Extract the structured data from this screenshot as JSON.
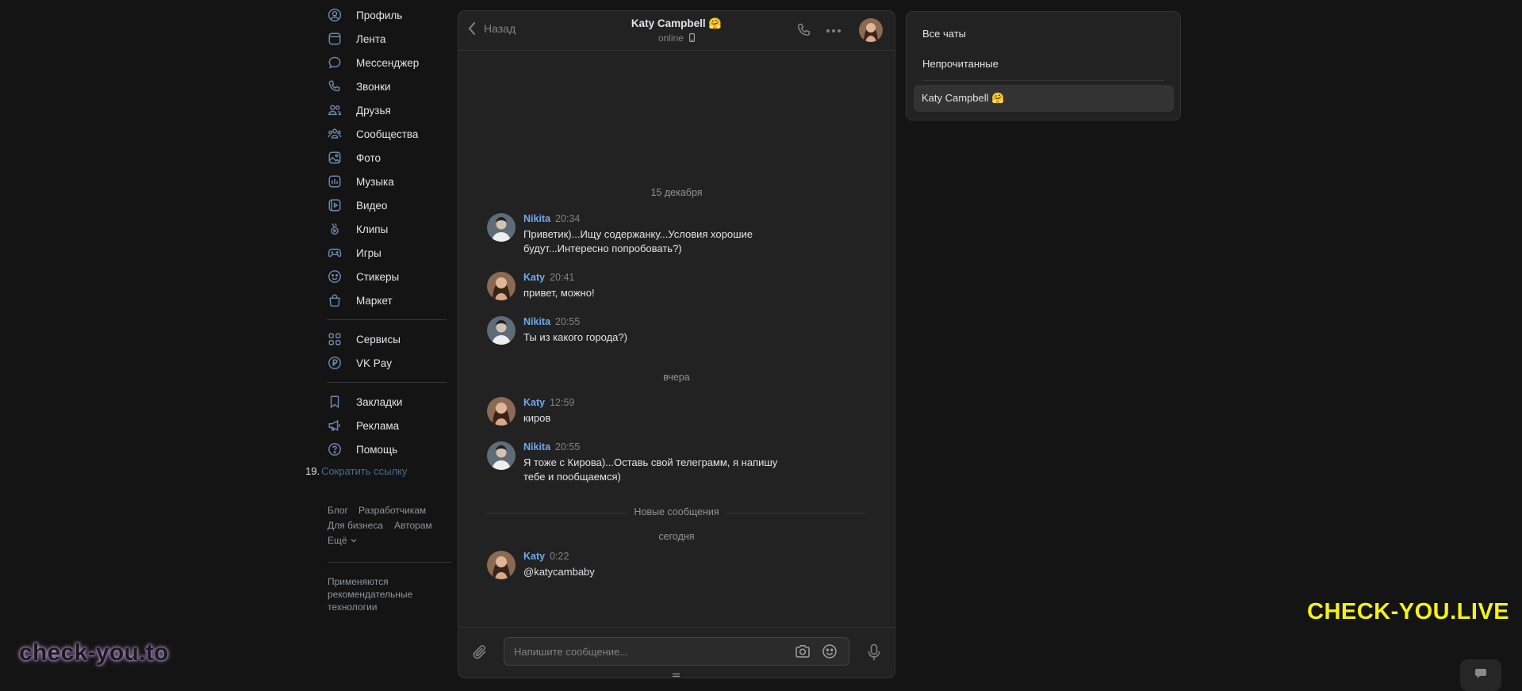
{
  "sidebar": {
    "items": [
      {
        "label": "Профиль",
        "icon": "user-circle-icon"
      },
      {
        "label": "Лента",
        "icon": "newsfeed-icon"
      },
      {
        "label": "Мессенджер",
        "icon": "message-bubble-icon"
      },
      {
        "label": "Звонки",
        "icon": "phone-icon"
      },
      {
        "label": "Друзья",
        "icon": "friends-icon"
      },
      {
        "label": "Сообщества",
        "icon": "communities-icon"
      },
      {
        "label": "Фото",
        "icon": "photo-icon"
      },
      {
        "label": "Музыка",
        "icon": "music-icon"
      },
      {
        "label": "Видео",
        "icon": "video-icon"
      },
      {
        "label": "Клипы",
        "icon": "clips-icon"
      },
      {
        "label": "Игры",
        "icon": "gamepad-icon"
      },
      {
        "label": "Стикеры",
        "icon": "sticker-smile-icon"
      },
      {
        "label": "Маркет",
        "icon": "shopping-bag-icon"
      },
      {
        "label": "Сервисы",
        "icon": "grid-services-icon"
      },
      {
        "label": "VK Pay",
        "icon": "ruble-icon"
      },
      {
        "label": "Закладки",
        "icon": "bookmark-icon"
      },
      {
        "label": "Реклама",
        "icon": "megaphone-icon"
      },
      {
        "label": "Помощь",
        "icon": "help-circle-icon"
      }
    ],
    "shortlink": {
      "number": "19.",
      "label": "Сократить ссылку"
    },
    "footer": {
      "links": [
        "Блог",
        "Разработчикам",
        "Для бизнеса",
        "Авторам",
        "Ещё"
      ],
      "note": "Применяются рекомендательные технологии"
    }
  },
  "chat": {
    "back_label": "Назад",
    "title": "Katy Campbell",
    "title_emoji": "🤗",
    "status": "online",
    "days": {
      "first": "15 декабря",
      "second": "вчера",
      "third": "сегодня"
    },
    "messages": [
      {
        "author": "Nikita",
        "time": "20:34",
        "text": "Приветик)...Ищу содержанку...Условия хорошие будут...Интересно попробовать?)"
      },
      {
        "author": "Katy",
        "time": "20:41",
        "text": "привет, можно!"
      },
      {
        "author": "Nikita",
        "time": "20:55",
        "text": "Ты из какого города?)"
      },
      {
        "author": "Katy",
        "time": "12:59",
        "text": "киров"
      },
      {
        "author": "Nikita",
        "time": "20:55",
        "text": "Я тоже с Кирова)...Оставь свой телеграмм, я напишу тебе и пообщаемся)"
      },
      {
        "author": "Katy",
        "time": "0:22",
        "text": "@katycambaby"
      }
    ],
    "new_messages_label": "Новые сообщения",
    "composer": {
      "placeholder": "Напишите сообщение..."
    }
  },
  "folders": {
    "items": [
      "Все чаты",
      "Непрочитанные"
    ],
    "active_chat": "Katy Campbell 🤗"
  },
  "watermarks": {
    "right": "CHECK-YOU.LIVE",
    "left": "check-you.to"
  },
  "colors": {
    "background": "#141414",
    "panel": "#222222",
    "accent_author": "#71aaeb",
    "nav_icon": "#6c89ad",
    "watermark_yellow": "#f2f21a"
  }
}
